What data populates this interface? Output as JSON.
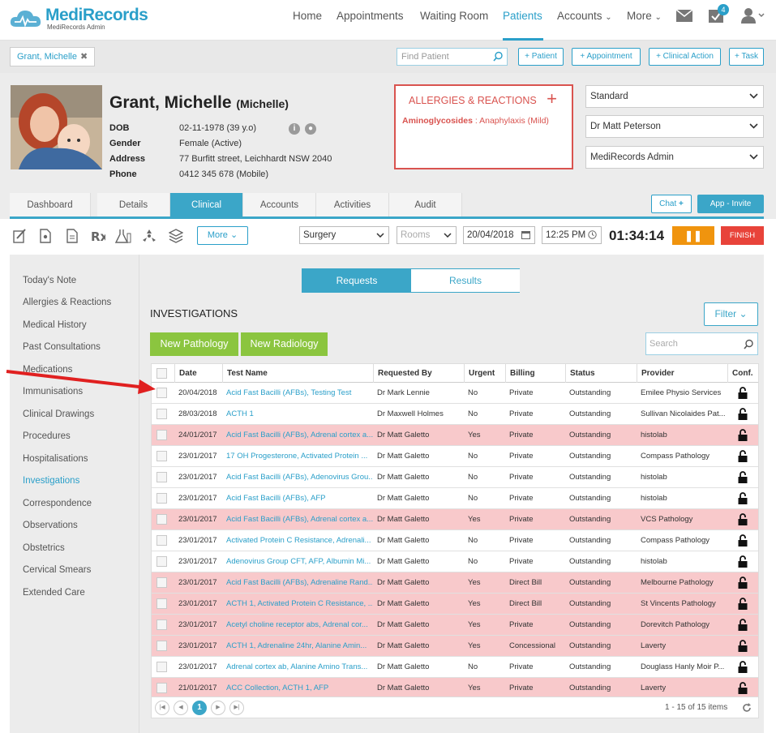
{
  "app": {
    "logo_name": "MediRecords",
    "logo_sub": "MediRecords Admin"
  },
  "nav": {
    "items": [
      {
        "label": "Home"
      },
      {
        "label": "Appointments"
      },
      {
        "label": "Waiting Room"
      },
      {
        "label": "Patients"
      },
      {
        "label": "Accounts"
      },
      {
        "label": "More"
      }
    ],
    "active": "Patients",
    "tasks_badge": "4"
  },
  "actionbar": {
    "patient_chip": "Grant, Michelle",
    "find_placeholder": "Find Patient",
    "buttons": [
      "+ Patient",
      "+ Appointment",
      "+ Clinical Action",
      "+ Task"
    ]
  },
  "patient": {
    "name": "Grant, Michelle",
    "preferred": "(Michelle)",
    "fields": [
      {
        "key": "DOB",
        "value": "02-11-1978 (39 y.o)"
      },
      {
        "key": "Gender",
        "value": "Female (Active)"
      },
      {
        "key": "Address",
        "value": "77 Burfitt street, Leichhardt NSW 2040"
      },
      {
        "key": "Phone",
        "value": "0412 345 678 (Mobile)"
      }
    ]
  },
  "allergies": {
    "title": "ALLERGIES & REACTIONS",
    "item_name": "Aminoglycosides",
    "item_reaction": " : Anaphylaxis (Mild)"
  },
  "selects": {
    "fee": "Standard",
    "doctor": "Dr Matt Peterson",
    "location": "MediRecords Admin"
  },
  "tabs": [
    "Dashboard",
    "Details",
    "Clinical",
    "Accounts",
    "Activities",
    "Audit"
  ],
  "active_tab": "Clinical",
  "chat_label": "Chat",
  "invite_label": "App - Invite",
  "toolbar": {
    "more_label": "More",
    "visit_type": "Surgery",
    "rooms_placeholder": "Rooms",
    "date": "20/04/2018",
    "time": "12:25 PM",
    "timer": "01:34:14",
    "finish_label": "FINISH"
  },
  "sidebar": {
    "items": [
      "Today's Note",
      "Allergies & Reactions",
      "Medical History",
      "Past Consultations",
      "Medications",
      "Immunisations",
      "Clinical Drawings",
      "Procedures",
      "Hospitalisations",
      "Investigations",
      "Correspondence",
      "Observations",
      "Obstetrics",
      "Cervical Smears",
      "Extended Care"
    ],
    "active": "Investigations"
  },
  "investigations": {
    "segment_requests": "Requests",
    "segment_results": "Results",
    "title": "INVESTIGATIONS",
    "filter_label": "Filter",
    "new_pathology": "New Pathology",
    "new_radiology": "New Radiology",
    "search_placeholder": "Search",
    "columns": [
      "Date",
      "Test Name",
      "Requested By",
      "Urgent",
      "Billing",
      "Status",
      "Provider",
      "Conf."
    ],
    "rows": [
      {
        "date": "20/04/2018",
        "test": "Acid Fast Bacilli (AFBs), Testing Test",
        "by": "Dr Mark Lennie",
        "urgent": "No",
        "billing": "Private",
        "status": "Outstanding",
        "provider": "Emilee Physio Services"
      },
      {
        "date": "28/03/2018",
        "test": "ACTH 1",
        "by": "Dr Maxwell Holmes",
        "urgent": "No",
        "billing": "Private",
        "status": "Outstanding",
        "provider": "Sullivan Nicolaides Pat..."
      },
      {
        "date": "24/01/2017",
        "test": "Acid Fast Bacilli (AFBs), Adrenal cortex a...",
        "by": "Dr Matt Galetto",
        "urgent": "Yes",
        "billing": "Private",
        "status": "Outstanding",
        "provider": "histolab"
      },
      {
        "date": "23/01/2017",
        "test": "17 OH Progesterone, Activated Protein ...",
        "by": "Dr Matt Galetto",
        "urgent": "No",
        "billing": "Private",
        "status": "Outstanding",
        "provider": "Compass Pathology"
      },
      {
        "date": "23/01/2017",
        "test": "Acid Fast Bacilli (AFBs), Adenovirus Grou...",
        "by": "Dr Matt Galetto",
        "urgent": "No",
        "billing": "Private",
        "status": "Outstanding",
        "provider": "histolab"
      },
      {
        "date": "23/01/2017",
        "test": "Acid Fast Bacilli (AFBs), AFP",
        "by": "Dr Matt Galetto",
        "urgent": "No",
        "billing": "Private",
        "status": "Outstanding",
        "provider": "histolab"
      },
      {
        "date": "23/01/2017",
        "test": "Acid Fast Bacilli (AFBs), Adrenal cortex a...",
        "by": "Dr Matt Galetto",
        "urgent": "Yes",
        "billing": "Private",
        "status": "Outstanding",
        "provider": "VCS Pathology"
      },
      {
        "date": "23/01/2017",
        "test": "Activated Protein C Resistance, Adrenali...",
        "by": "Dr Matt Galetto",
        "urgent": "No",
        "billing": "Private",
        "status": "Outstanding",
        "provider": "Compass Pathology"
      },
      {
        "date": "23/01/2017",
        "test": "Adenovirus Group CFT, AFP, Albumin Mi...",
        "by": "Dr Matt Galetto",
        "urgent": "No",
        "billing": "Private",
        "status": "Outstanding",
        "provider": "histolab"
      },
      {
        "date": "23/01/2017",
        "test": "Acid Fast Bacilli (AFBs), Adrenaline Rand...",
        "by": "Dr Matt Galetto",
        "urgent": "Yes",
        "billing": "Direct Bill",
        "status": "Outstanding",
        "provider": "Melbourne Pathology"
      },
      {
        "date": "23/01/2017",
        "test": "ACTH 1, Activated Protein C Resistance, ...",
        "by": "Dr Matt Galetto",
        "urgent": "Yes",
        "billing": "Direct Bill",
        "status": "Outstanding",
        "provider": "St Vincents Pathology"
      },
      {
        "date": "23/01/2017",
        "test": "Acetyl choline receptor abs, Adrenal cor...",
        "by": "Dr Matt Galetto",
        "urgent": "Yes",
        "billing": "Private",
        "status": "Outstanding",
        "provider": "Dorevitch Pathology"
      },
      {
        "date": "23/01/2017",
        "test": "ACTH 1, Adrenaline 24hr, Alanine Amin...",
        "by": "Dr Matt Galetto",
        "urgent": "Yes",
        "billing": "Concessional",
        "status": "Outstanding",
        "provider": "Laverty"
      },
      {
        "date": "23/01/2017",
        "test": "Adrenal cortex ab, Alanine Amino Trans...",
        "by": "Dr Matt Galetto",
        "urgent": "No",
        "billing": "Private",
        "status": "Outstanding",
        "provider": "Douglass Hanly Moir P..."
      },
      {
        "date": "21/01/2017",
        "test": "ACC Collection, ACTH 1, AFP",
        "by": "Dr Matt Galetto",
        "urgent": "Yes",
        "billing": "Private",
        "status": "Outstanding",
        "provider": "Laverty"
      }
    ],
    "page": "1",
    "page_info": "1 - 15 of 15 items"
  },
  "colors": {
    "brand": "#2a9fc9",
    "urgent_row": "#f8c9cb",
    "allergy": "#d9534f",
    "green_button": "#8bc53f",
    "pause": "#f0940e",
    "finish": "#e8433a",
    "annotation_arrow": "#e02020"
  }
}
